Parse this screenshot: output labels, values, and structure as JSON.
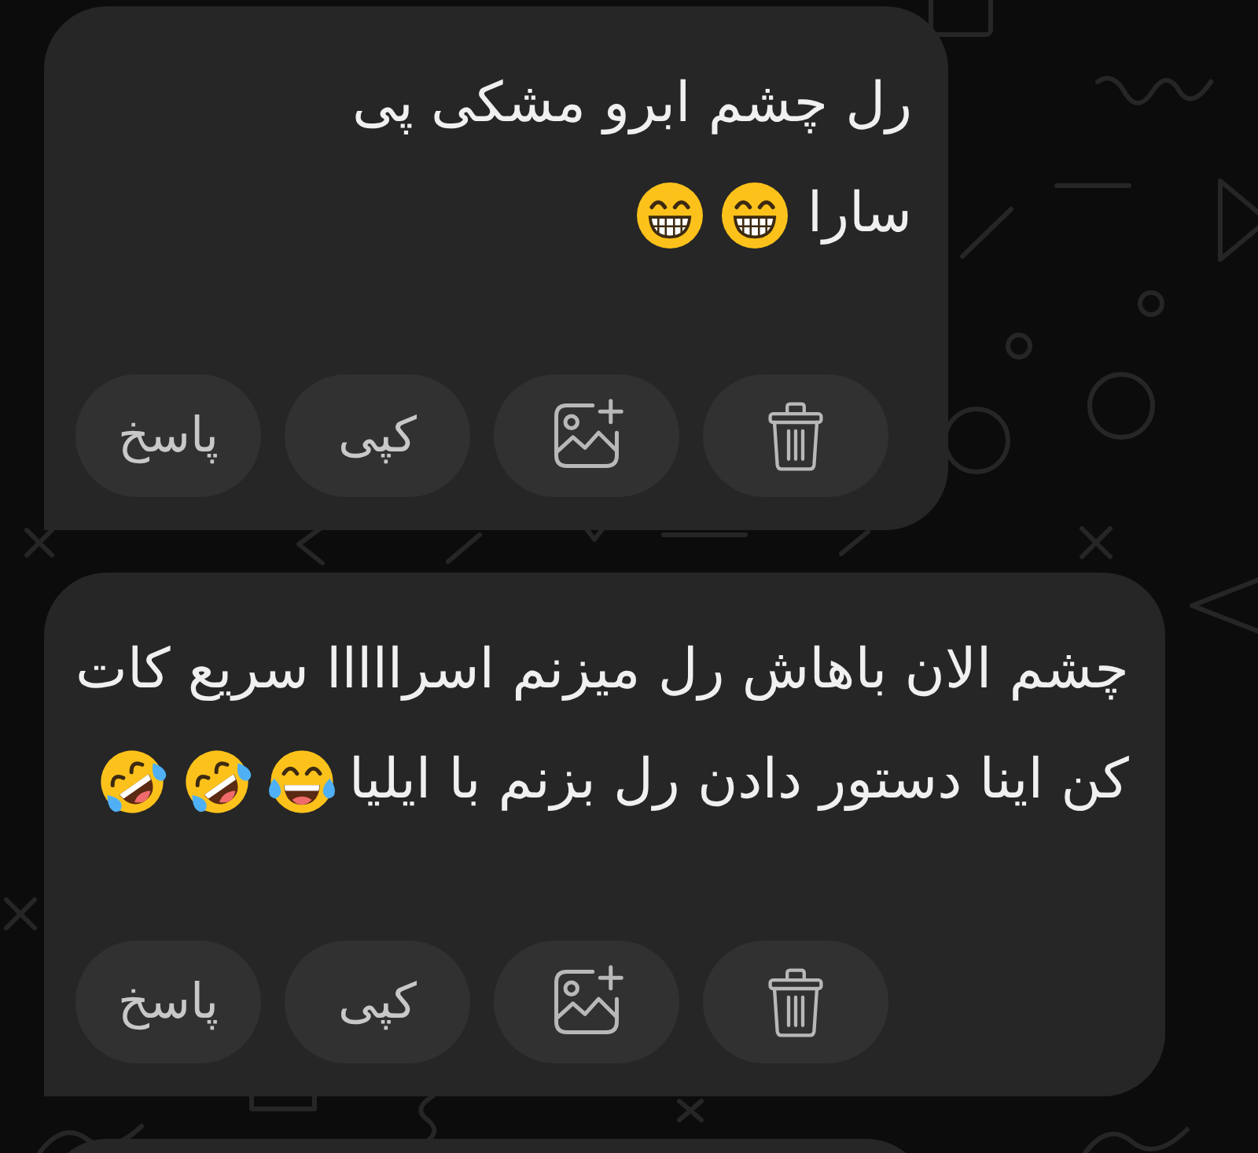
{
  "messages": [
    {
      "kind": "text",
      "lines": [
        {
          "text": "رل چشم ابرو مشکی پی"
        },
        {
          "text": "سارا",
          "emoji": [
            {
              "kind": "grin"
            },
            {
              "kind": "grin"
            }
          ]
        }
      ],
      "actions": [
        {
          "kind": "delete"
        },
        {
          "kind": "add_image"
        },
        {
          "kind": "copy",
          "label": "کپی"
        },
        {
          "kind": "reply",
          "label": "پاسخ"
        }
      ]
    },
    {
      "kind": "text",
      "lines": [
        {
          "text": "چشم الان باهاش رل میزنم اسرااااا سریع کات"
        },
        {
          "text": "کن اینا دستور دادن رل بزنم با ایلیا",
          "emoji": [
            {
              "kind": "joy"
            },
            {
              "kind": "rofl"
            },
            {
              "kind": "rofl"
            }
          ]
        }
      ],
      "actions": [
        {
          "kind": "delete"
        },
        {
          "kind": "add_image"
        },
        {
          "kind": "copy",
          "label": "کپی"
        },
        {
          "kind": "reply",
          "label": "پاسخ"
        }
      ]
    },
    {
      "kind": "cut_off"
    }
  ]
}
